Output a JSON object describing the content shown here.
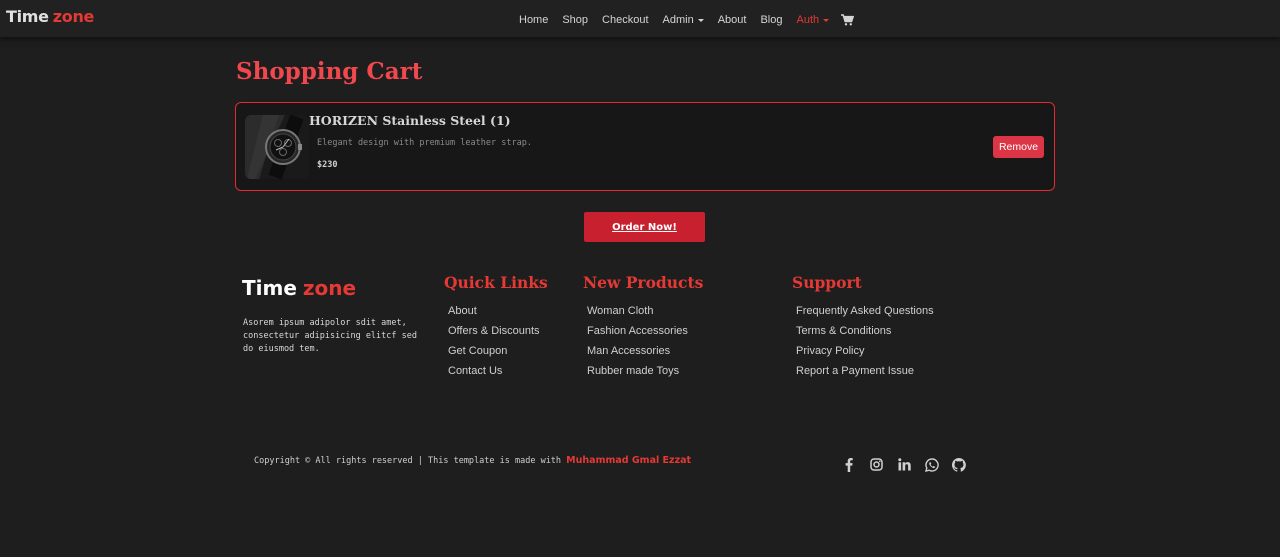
{
  "brand": {
    "part1": "Time",
    "part2": "zone"
  },
  "nav": {
    "links": [
      "Home",
      "Shop",
      "Checkout",
      "Admin",
      "About",
      "Blog",
      "Auth"
    ]
  },
  "page": {
    "title": "Shopping Cart"
  },
  "cart": {
    "items": [
      {
        "title": "HORIZEN Stainless Steel (1)",
        "description": "Elegant design with premium leather strap.",
        "price": "$230",
        "remove_label": "Remove"
      }
    ],
    "order_label": "Order Now!"
  },
  "footer": {
    "brand": {
      "part1": "Time",
      "part2": "zone"
    },
    "about": "Asorem ipsum adipolor sdit amet, consectetur adipisicing elitcf sed do eiusmod tem.",
    "columns": [
      {
        "heading": "Quick Links",
        "items": [
          "About",
          "Offers & Discounts",
          "Get Coupon",
          "Contact Us"
        ]
      },
      {
        "heading": "New Products",
        "items": [
          "Woman Cloth",
          "Fashion Accessories",
          "Man Accessories",
          "Rubber made Toys"
        ]
      },
      {
        "heading": "Support",
        "items": [
          "Frequently Asked Questions",
          "Terms & Conditions",
          "Privacy Policy",
          "Report a Payment Issue"
        ]
      }
    ],
    "copyright": "Copyright © All rights reserved | This template is made with",
    "author": "Muhammad Gmal Ezzat",
    "socials": [
      "facebook-icon",
      "instagram-icon",
      "linkedin-icon",
      "whatsapp-icon",
      "github-icon"
    ]
  },
  "colors": {
    "accent": "#e53935",
    "button": "#dc3545",
    "background": "#1e1e1e"
  }
}
